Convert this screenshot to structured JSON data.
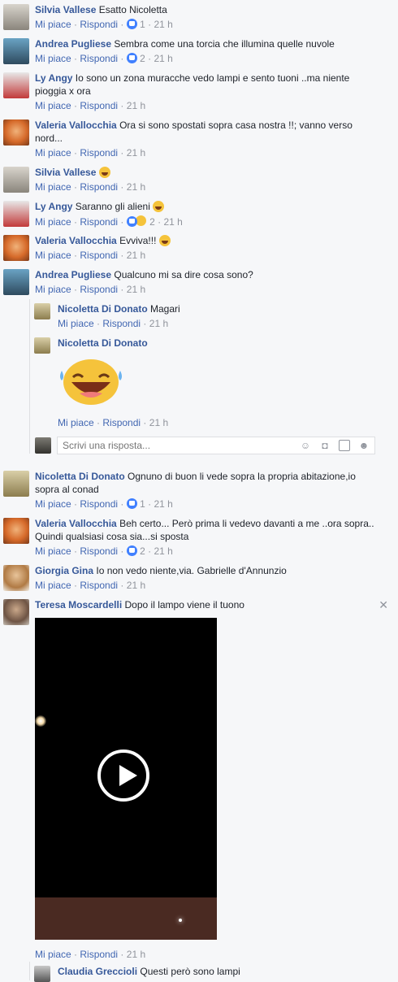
{
  "labels": {
    "like": "Mi piace",
    "reply": "Rispondi",
    "sep": "·"
  },
  "comments": [
    {
      "name": "Silvia Vallese",
      "text": "Esatto Nicoletta",
      "likes": "1",
      "time": "21 h"
    },
    {
      "name": "Andrea Pugliese",
      "text": "Sembra come una torcia che illumina quelle nuvole",
      "likes": "2",
      "time": "21 h"
    },
    {
      "name": "Ly Angy",
      "text": "Io sono un zona muracche vedo lampi e sento tuoni ..ma niente pioggia x ora",
      "time": "21 h"
    },
    {
      "name": "Valeria Vallocchia",
      "text": "Ora si sono spostati sopra casa nostra !!; vanno verso nord...",
      "time": "21 h"
    },
    {
      "name": "Silvia Vallese",
      "text": "",
      "time": "21 h"
    },
    {
      "name": "Ly Angy",
      "text": "Saranno gli alieni",
      "likes": "2",
      "time": "21 h"
    },
    {
      "name": "Valeria Vallocchia",
      "text": "Evviva!!!",
      "time": "21 h"
    },
    {
      "name": "Andrea Pugliese",
      "text": "Qualcuno mi sa dire cosa sono?",
      "time": "21 h"
    }
  ],
  "replies": [
    {
      "name": "Nicoletta Di Donato",
      "text": "Magari",
      "time": "21 h"
    },
    {
      "name": "Nicoletta Di Donato",
      "text": "",
      "time": "21 h"
    }
  ],
  "reply_box": {
    "placeholder": "Scrivi una risposta..."
  },
  "comments2": [
    {
      "name": "Nicoletta Di Donato",
      "text": "Ognuno di buon li vede sopra la propria abitazione,io sopra al conad",
      "likes": "1",
      "time": "21 h"
    },
    {
      "name": "Valeria Vallocchia",
      "text": "Beh certo... Però prima li vedevo davanti a me ..ora sopra.. Quindi qualsiasi cosa sia...si sposta",
      "likes": "2",
      "time": "21 h"
    },
    {
      "name": "Giorgia Gina",
      "text": "Io non vedo niente,via. Gabrielle d'Annunzio",
      "time": "21 h"
    },
    {
      "name": "Teresa Moscardelli",
      "text": "Dopo il lampo viene il tuono",
      "time": "21 h"
    }
  ],
  "last_reply": {
    "name": "Claudia Greccioli",
    "text": "Questi però sono lampi"
  },
  "colors": {
    "link": "#365899",
    "action": "#4267b2",
    "meta": "#90949c",
    "bg": "#f6f7f9"
  }
}
